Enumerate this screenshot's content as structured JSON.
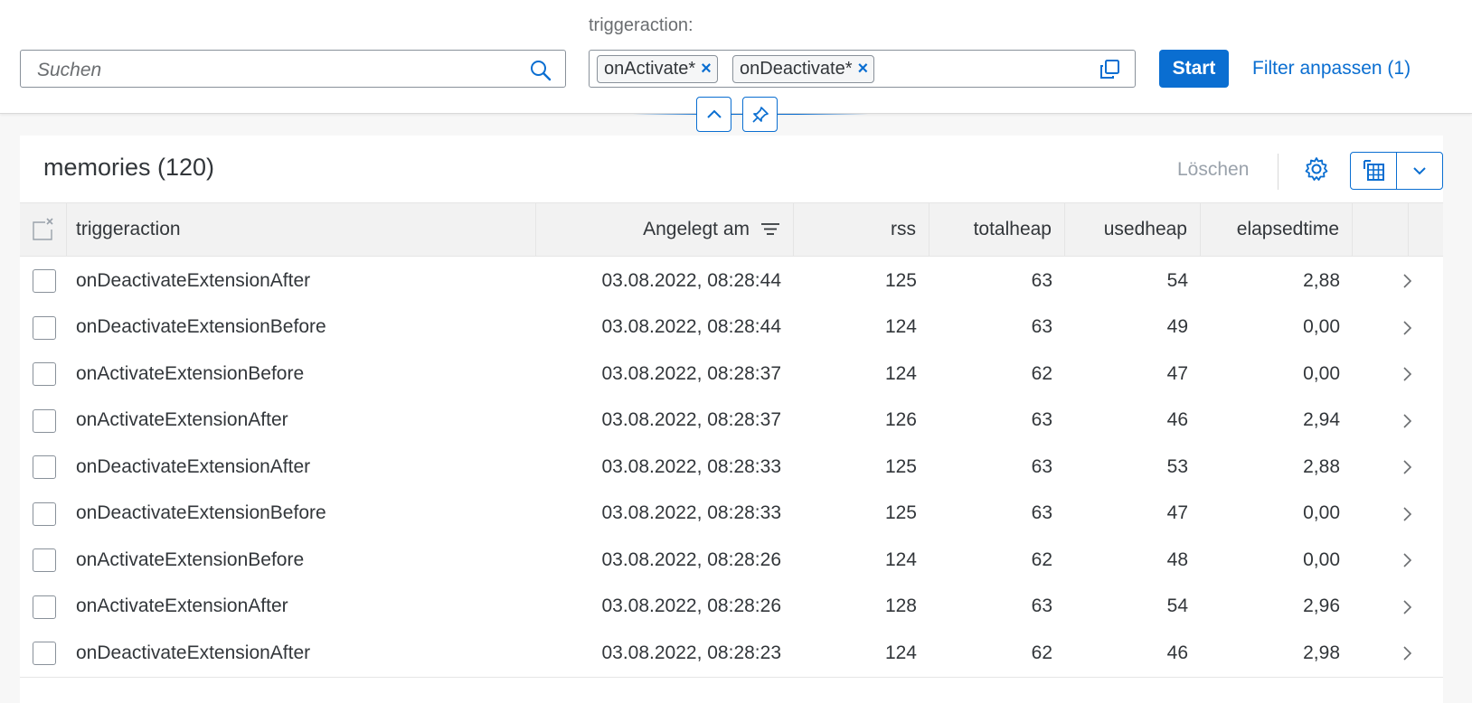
{
  "filterbar": {
    "search_placeholder": "Suchen",
    "filter_label": "triggeraction:",
    "tokens": [
      "onActivate*",
      "onDeactivate*"
    ],
    "token_remove": "×",
    "go_label": "Start",
    "adapt_label": "Filter anpassen (1)"
  },
  "table": {
    "title": "memories (120)",
    "delete_label": "Löschen",
    "columns": [
      "triggeraction",
      "Angelegt am",
      "rss",
      "totalheap",
      "usedheap",
      "elapsedtime"
    ],
    "rows": [
      {
        "triggeraction": "onDeactivateExtensionAfter",
        "created": "03.08.2022, 08:28:44",
        "rss": "125",
        "totalheap": "63",
        "usedheap": "54",
        "elapsedtime": "2,88"
      },
      {
        "triggeraction": "onDeactivateExtensionBefore",
        "created": "03.08.2022, 08:28:44",
        "rss": "124",
        "totalheap": "63",
        "usedheap": "49",
        "elapsedtime": "0,00"
      },
      {
        "triggeraction": "onActivateExtensionBefore",
        "created": "03.08.2022, 08:28:37",
        "rss": "124",
        "totalheap": "62",
        "usedheap": "47",
        "elapsedtime": "0,00"
      },
      {
        "triggeraction": "onActivateExtensionAfter",
        "created": "03.08.2022, 08:28:37",
        "rss": "126",
        "totalheap": "63",
        "usedheap": "46",
        "elapsedtime": "2,94"
      },
      {
        "triggeraction": "onDeactivateExtensionAfter",
        "created": "03.08.2022, 08:28:33",
        "rss": "125",
        "totalheap": "63",
        "usedheap": "53",
        "elapsedtime": "2,88"
      },
      {
        "triggeraction": "onDeactivateExtensionBefore",
        "created": "03.08.2022, 08:28:33",
        "rss": "125",
        "totalheap": "63",
        "usedheap": "47",
        "elapsedtime": "0,00"
      },
      {
        "triggeraction": "onActivateExtensionBefore",
        "created": "03.08.2022, 08:28:26",
        "rss": "124",
        "totalheap": "62",
        "usedheap": "48",
        "elapsedtime": "0,00"
      },
      {
        "triggeraction": "onActivateExtensionAfter",
        "created": "03.08.2022, 08:28:26",
        "rss": "128",
        "totalheap": "63",
        "usedheap": "54",
        "elapsedtime": "2,96"
      },
      {
        "triggeraction": "onDeactivateExtensionAfter",
        "created": "03.08.2022, 08:28:23",
        "rss": "124",
        "totalheap": "62",
        "usedheap": "46",
        "elapsedtime": "2,98"
      }
    ]
  },
  "colors": {
    "accent": "#0a6ed1",
    "text": "#32363a",
    "muted": "#6a6d70",
    "disabled": "#9aa2ab"
  },
  "icons": [
    "search-icon",
    "close-icon",
    "value-help-icon",
    "chevron-up-icon",
    "pin-icon",
    "gear-icon",
    "export-spreadsheet-icon",
    "chevron-down-icon",
    "select-all-icon",
    "sort-icon",
    "chevron-right-icon"
  ]
}
